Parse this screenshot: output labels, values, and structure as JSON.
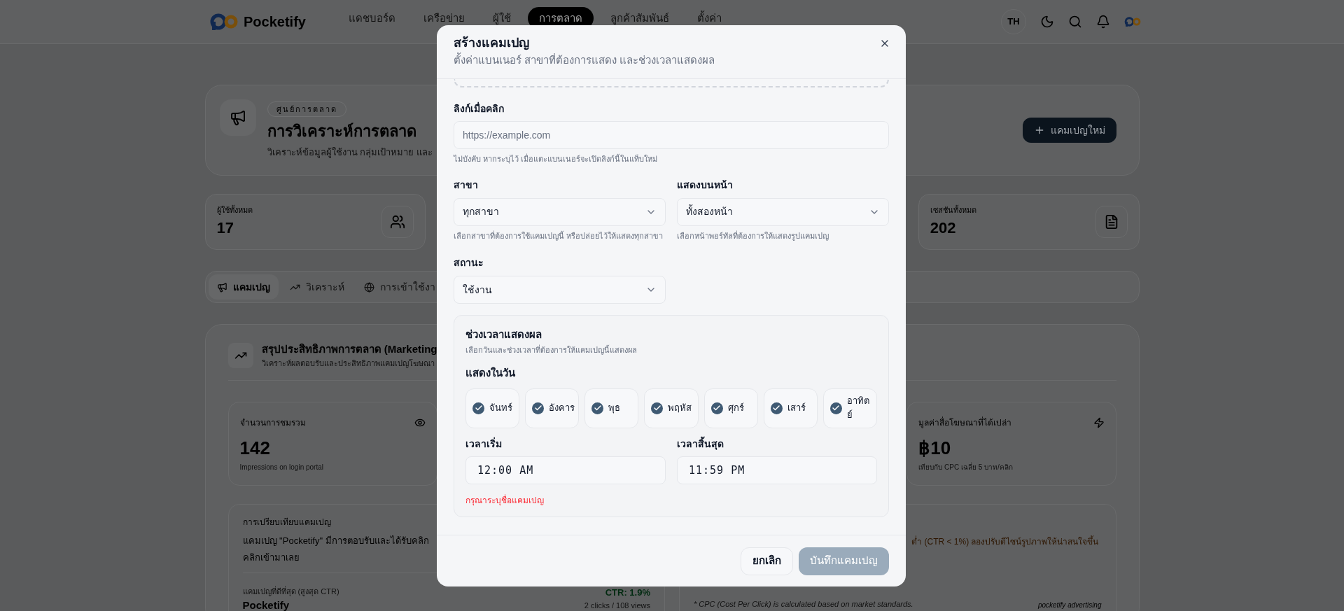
{
  "nav": {
    "brand": "Pocketify",
    "items": [
      {
        "label": "แดชบอร์ด",
        "selected": false
      },
      {
        "label": "เครือข่าย",
        "selected": false
      },
      {
        "label": "ผู้ใช้",
        "selected": false
      },
      {
        "label": "การตลาด",
        "selected": true
      },
      {
        "label": "ลูกค้าสัมพันธ์",
        "selected": false
      },
      {
        "label": "ตั้งค่า",
        "selected": false
      }
    ],
    "language": "TH"
  },
  "header": {
    "badge": "ศูนย์การตลาด",
    "title": "การวิเคราะห์การตลาด",
    "subtitle": "วิเคราะห์ข้อมูลผู้ใช้งาน กลุ่มเป้าหมาย และ",
    "button": "แคมเปญใหม่"
  },
  "stats": [
    {
      "kind": "users",
      "label": "ผู้ใช้ทั้งหมด",
      "value": "17"
    },
    {
      "kind": "sessions",
      "label": "เซสชันทั้งหมด",
      "value": "202"
    }
  ],
  "tabs": [
    {
      "kind": "megaphone",
      "label": "แคมเปญ",
      "selected": true
    },
    {
      "kind": "trend",
      "label": "วิเคราะห์",
      "selected": false
    },
    {
      "kind": "globe",
      "label": "การเข้าใช้งา",
      "selected": false
    }
  ],
  "summary": {
    "title": "สรุปประสิทธิภาพการตลาด (Marketing",
    "subtitle": "วิเคราะห์ผลตอบรับและประสิทธิภาพแคมเปญโฆษณา",
    "metrics": [
      {
        "kind": "eye",
        "label": "จำนวนการชมรวม",
        "value": "142",
        "caption": "Impressions on login portal"
      },
      {
        "kind": "zap",
        "label": "มูลค่าสื่อโฆษณาที่ได้เปล่า",
        "value": "฿10",
        "caption": "เทียบกับ CPC เฉลี่ย 5 บาท/คลิก"
      }
    ],
    "comparison": {
      "heading": "การเปรียบเทียบแคมเปญ",
      "text": "แคมเปญ \"Pocketify\" มีการตอบรับและได้รับคลิก",
      "text_cont": "คลิกเข้ามาเลย",
      "best_label": "แคมเปญที่ดีที่สุด (สูงสุด CTR)",
      "best_name": "Pocketify",
      "ctr": "CTR: 1.9%",
      "clicks": "2 clicks / 108 views"
    },
    "tip": "ต่ำ (CTR < 1%) ลองปรับดีไซน์รูปภาพให้น่าสนใจขึ้น",
    "footnote": "* CPC (Cost Per Click) is calculated based on market standards.",
    "brand_note": "pocketify advertising"
  },
  "modal": {
    "title": "สร้างแคมเปญ",
    "subtitle": "ตั้งค่าแบนเนอร์ สาขาที่ต้องการแสดง และช่วงเวลาแสดงผล",
    "link": {
      "label": "ลิงก์เมื่อคลิก",
      "placeholder": "https://example.com",
      "help": "ไม่บังคับ หากระบุไว้ เมื่อแตะแบนเนอร์จะเปิดลิงก์นี้ในแท็บใหม่"
    },
    "branch": {
      "label": "สาขา",
      "value": "ทุกสาขา",
      "help": "เลือกสาขาที่ต้องการใช้แคมเปญนี้ หรือปล่อยไว้ให้แสดงทุกสาขา"
    },
    "page": {
      "label": "แสดงบนหน้า",
      "value": "ทั้งสองหน้า",
      "help": "เลือกหน้าพอร์ทัลที่ต้องการให้แสดงรูปแคมเปญ"
    },
    "status": {
      "label": "สถานะ",
      "value": "ใช้งาน"
    },
    "schedule": {
      "title": "ช่วงเวลาแสดงผล",
      "subtitle": "เลือกวันและช่วงเวลาที่ต้องการให้แคมเปญนี้แสดงผล",
      "days_label": "แสดงในวัน",
      "days": [
        {
          "label": "จันทร์",
          "checked": true
        },
        {
          "label": "อังคาร",
          "checked": true
        },
        {
          "label": "พุธ",
          "checked": true
        },
        {
          "label": "พฤหัส",
          "checked": true
        },
        {
          "label": "ศุกร์",
          "checked": true
        },
        {
          "label": "เสาร์",
          "checked": true
        },
        {
          "label": "อาทิตย์",
          "checked": true
        }
      ],
      "start": {
        "label": "เวลาเริ่ม",
        "value": "12:00 AM"
      },
      "end": {
        "label": "เวลาสิ้นสุด",
        "value": "11:59 PM"
      },
      "error": "กรุณาระบุชื่อแคมเปญ"
    },
    "cancel": "ยกเลิก",
    "save": {
      "label": "บันทึกแคมเปญ",
      "disabled": true
    }
  }
}
